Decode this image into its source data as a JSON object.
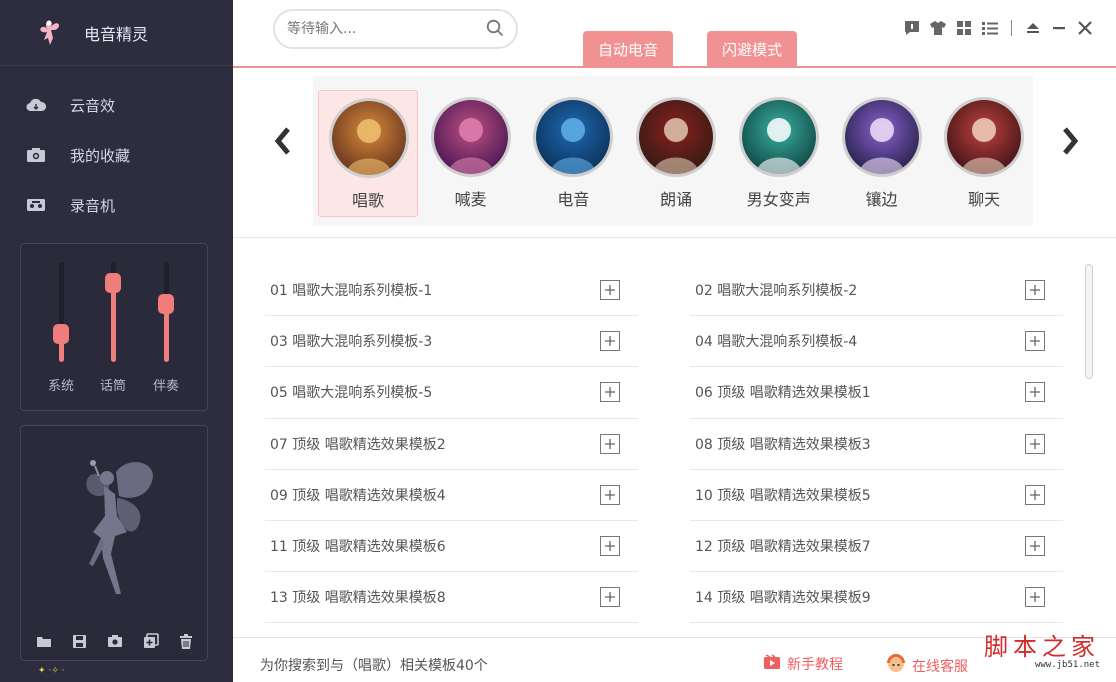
{
  "app": {
    "title": "电音精灵"
  },
  "sidebar": {
    "items": [
      {
        "label": "云音效",
        "icon": "cloud-icon"
      },
      {
        "label": "我的收藏",
        "icon": "camera-icon"
      },
      {
        "label": "录音机",
        "icon": "recorder-icon"
      }
    ],
    "mixer": [
      {
        "label": "系统",
        "level": 0.22
      },
      {
        "label": "话筒",
        "level": 0.86
      },
      {
        "label": "伴奏",
        "level": 0.6
      }
    ],
    "fairy_tools": [
      "folder-icon",
      "save-icon",
      "camera-icon",
      "add-icon",
      "trash-icon"
    ]
  },
  "search": {
    "placeholder": "等待输入..."
  },
  "modes": [
    {
      "label": "自动电音"
    },
    {
      "label": "闪避模式"
    }
  ],
  "categories": [
    {
      "label": "唱歌",
      "active": true
    },
    {
      "label": "喊麦",
      "active": false
    },
    {
      "label": "电音",
      "active": false
    },
    {
      "label": "朗诵",
      "active": false
    },
    {
      "label": "男女变声",
      "active": false
    },
    {
      "label": "镶边",
      "active": false
    },
    {
      "label": "聊天",
      "active": false
    }
  ],
  "templates": {
    "left": [
      "01 唱歌大混响系列模板-1",
      "03 唱歌大混响系列模板-3",
      "05 唱歌大混响系列模板-5",
      "07 顶级 唱歌精选效果模板2",
      "09 顶级 唱歌精选效果模板4",
      "11 顶级 唱歌精选效果模板6",
      "13 顶级 唱歌精选效果模板8"
    ],
    "right": [
      "02 唱歌大混响系列模板-2",
      "04 唱歌大混响系列模板-4",
      "06 顶级 唱歌精选效果模板1",
      "08 顶级 唱歌精选效果模板3",
      "10 顶级 唱歌精选效果模板5",
      "12 顶级 唱歌精选效果模板7",
      "14 顶级 唱歌精选效果模板9"
    ]
  },
  "footer": {
    "status": "为你搜索到与（唱歌）相关模板40个",
    "tutorial": "新手教程",
    "support": "在线客服"
  },
  "watermark": {
    "title": "脚本之家",
    "url": "www.jb51.net"
  },
  "colors": {
    "accent": "#f29191",
    "sidebar_bg": "#2d2d3f"
  }
}
